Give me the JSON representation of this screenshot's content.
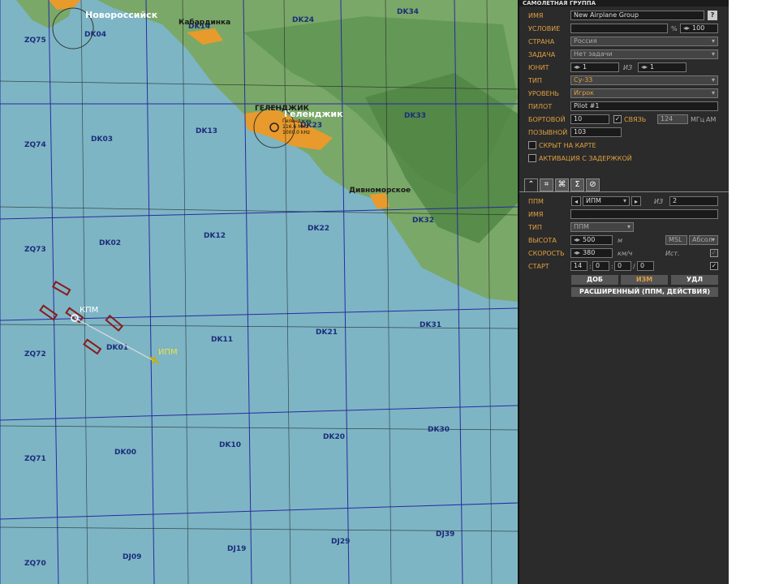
{
  "map": {
    "grid_labels": [
      "ZQ75",
      "DK04",
      "DK14",
      "DK24",
      "DK34",
      "ZQ74",
      "DK03",
      "DK13",
      "DK23",
      "DK33",
      "ZQ73",
      "DK02",
      "DK12",
      "DK22",
      "DK32",
      "ZQ72",
      "DK01",
      "DK11",
      "DK21",
      "DK31",
      "ZQ71",
      "DK00",
      "DK10",
      "DK20",
      "DK30",
      "ZQ70",
      "DJ09",
      "DJ19",
      "DJ29",
      "DJ39"
    ],
    "cities": [
      "Новороссийск",
      "Геленджик"
    ],
    "city_caps": "ГЕЛЕНДЖИК",
    "towns": [
      "Кабардинка",
      "Дивноморское"
    ],
    "navaid_text": [
      "Геленджик",
      "116.6 MHz",
      "1000.0 kHz"
    ],
    "waypoints": [
      "КПМ",
      "ИПМ"
    ]
  },
  "panel": {
    "title": "САМОЛЕТНАЯ ГРУППА",
    "name_label": "ИМЯ",
    "name_value": "New Airplane Group",
    "help": "?",
    "condition_label": "УСЛОВИЕ",
    "condition_pct": "%",
    "condition_value": "100",
    "country_label": "СТРАНА",
    "country_value": "Россия",
    "task_label": "ЗАДАЧА",
    "task_value": "Нет задачи",
    "unit_label": "ЮНИТ",
    "unit_value": "1",
    "unit_of": "ИЗ",
    "unit_total": "1",
    "type_label": "ТИП",
    "type_value": "Су-33",
    "level_label": "УРОВЕНЬ",
    "level_value": "Игрок",
    "pilot_label": "ПИЛОТ",
    "pilot_value": "Pilot #1",
    "tail_label": "БОРТОВОЙ",
    "tail_value": "10",
    "comm_label": "СВЯЗЬ",
    "comm_freq": "124",
    "comm_units": "МГц",
    "comm_mod": "AM",
    "callsign_label": "ПОЗЫВНОЙ",
    "callsign_value": "103",
    "hidden_label": "СКРЫТ НА КАРТЕ",
    "delay_label": "АКТИВАЦИЯ С ЗАДЕРЖКОЙ",
    "tabs": [
      "⌃",
      "⌗",
      "⌘",
      "Σ",
      "⊘"
    ],
    "wp_label": "ППМ",
    "wp_value": "ИПМ",
    "wp_of": "ИЗ",
    "wp_total": "2",
    "wp_name_label": "ИМЯ",
    "wp_type_label": "ТИП",
    "wp_type_value": "ППМ",
    "alt_label": "ВЫСОТА",
    "alt_value": "500",
    "alt_unit": "м",
    "alt_ref": "MSL",
    "alt_mode": "Абсол",
    "speed_label": "СКОРОСТЬ",
    "speed_value": "380",
    "speed_unit": "км/ч",
    "speed_ist": "Ист.",
    "start_label": "СТАРТ",
    "start_h": "14",
    "start_m": "0",
    "start_s": "0",
    "start_d": "0",
    "btn_add": "ДОБ",
    "btn_edit": "ИЗМ",
    "btn_del": "УДЛ",
    "btn_advanced": "РАСШИРЕННЫЙ (ППМ, ДЕЙСТВИЯ)"
  }
}
